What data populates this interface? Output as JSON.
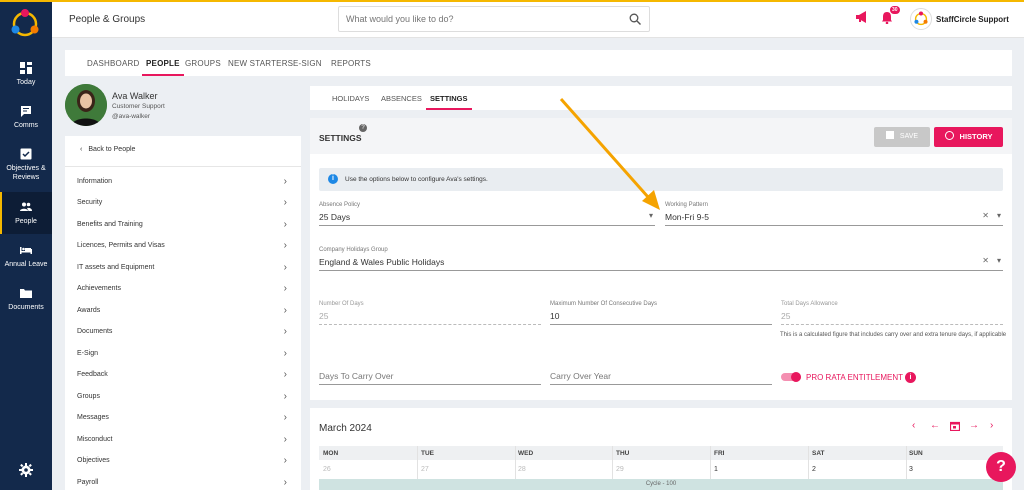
{
  "header": {
    "title": "People & Groups",
    "search_placeholder": "What would you like to do?",
    "notification_count": "30",
    "org_name": "StaffCircle Support"
  },
  "leftnav": {
    "items": [
      {
        "label": "Today"
      },
      {
        "label": "Comms"
      },
      {
        "label": "Objectives & Reviews"
      },
      {
        "label": "People"
      },
      {
        "label": "Annual Leave"
      },
      {
        "label": "Documents"
      }
    ]
  },
  "main_tabs": [
    "DASHBOARD",
    "PEOPLE",
    "GROUPS",
    "NEW STARTERS",
    "E-SIGN",
    "REPORTS"
  ],
  "profile": {
    "name": "Ava Walker",
    "role": "Customer Support",
    "handle": "@ava-walker"
  },
  "menu": {
    "back_label": "Back to People",
    "items": [
      "Information",
      "Security",
      "Benefits and Training",
      "Licences, Permits and Visas",
      "IT assets and Equipment",
      "Achievements",
      "Awards",
      "Documents",
      "E-Sign",
      "Feedback",
      "Groups",
      "Messages",
      "Misconduct",
      "Objectives",
      "Payroll"
    ]
  },
  "sub_tabs": [
    "HOLIDAYS",
    "ABSENCES",
    "SETTINGS"
  ],
  "settings": {
    "title": "SETTINGS",
    "help_mark": "?",
    "save_label": "SAVE",
    "history_label": "HISTORY",
    "info_text": "Use the options below to configure Ava's settings.",
    "absence_policy": {
      "label": "Absence Policy",
      "value": "25 Days"
    },
    "working_pattern": {
      "label": "Working Pattern",
      "value": "Mon-Fri 9-5"
    },
    "company_holidays": {
      "label": "Company Holidays Group",
      "value": "England & Wales Public Holidays"
    },
    "number_of_days": {
      "label": "Number Of Days",
      "value": "25"
    },
    "max_consecutive": {
      "label": "Maximum Number Of Consecutive Days",
      "value": "10"
    },
    "total_allowance": {
      "label": "Total Days Allowance",
      "value": "25",
      "note": "This is a calculated figure that includes carry over and extra tenure days, if applicable"
    },
    "carry_over_days_placeholder": "Days To Carry Over",
    "carry_over_year_placeholder": "Carry Over Year",
    "pro_rata_label": "PRO RATA ENTITLEMENT",
    "pro_rata_enabled": true
  },
  "calendar": {
    "month": "March 2024",
    "days": [
      "MON",
      "TUE",
      "WED",
      "THU",
      "FRI",
      "SAT",
      "SUN"
    ],
    "first_row": [
      {
        "n": "26",
        "in_month": false
      },
      {
        "n": "27",
        "in_month": false
      },
      {
        "n": "28",
        "in_month": false
      },
      {
        "n": "29",
        "in_month": false
      },
      {
        "n": "1",
        "in_month": true
      },
      {
        "n": "2",
        "in_month": true
      },
      {
        "n": "3",
        "in_month": true
      }
    ],
    "cycle_label": "Cycle - 100"
  },
  "colors": {
    "accent": "#e8175d",
    "nav_bg": "#13294b",
    "top_line": "#f5b800",
    "arrow": "#f5a300"
  }
}
